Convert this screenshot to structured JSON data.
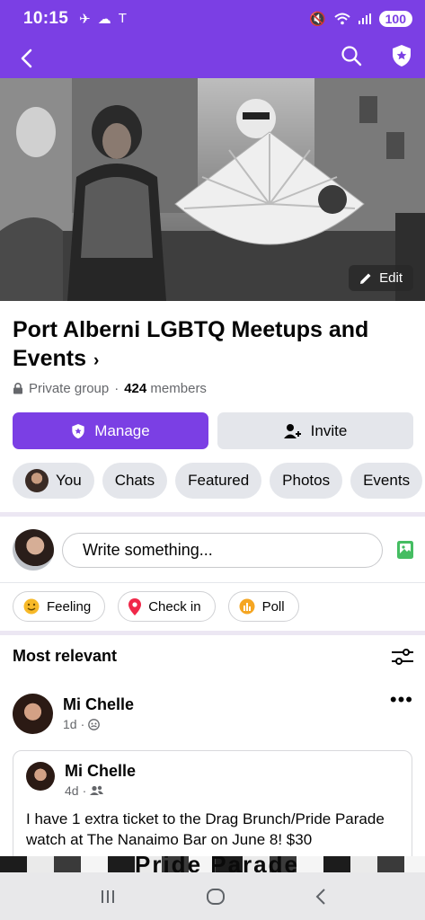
{
  "status_bar": {
    "time": "10:15",
    "battery": "100"
  },
  "cover": {
    "edit_label": "Edit"
  },
  "group": {
    "name": "Port Alberni LGBTQ Meetups and Events",
    "privacy": "Private group",
    "members_count": "424",
    "members_label": "members"
  },
  "buttons": {
    "manage": "Manage",
    "invite": "Invite"
  },
  "chips": [
    {
      "label": "You"
    },
    {
      "label": "Chats"
    },
    {
      "label": "Featured"
    },
    {
      "label": "Photos"
    },
    {
      "label": "Events"
    }
  ],
  "composer": {
    "placeholder": "Write something..."
  },
  "actions": [
    {
      "label": "Feeling",
      "icon": "smile-icon",
      "color": "#f7b928"
    },
    {
      "label": "Check in",
      "icon": "location-pin-icon",
      "color": "#f02849"
    },
    {
      "label": "Poll",
      "icon": "poll-icon",
      "color": "#f5a623"
    }
  ],
  "feed": {
    "sort_label": "Most relevant"
  },
  "post": {
    "author": "Mi Chelle",
    "time": "1d",
    "shared": {
      "author": "Mi Chelle",
      "time": "4d",
      "text": "I have 1 extra ticket to the Drag Brunch/Pride Parade watch at The Nanaimo Bar on June 8!  $30"
    }
  },
  "banner_text": "Pride Parade",
  "colors": {
    "brand": "#7b3fe4",
    "chip_bg": "#e4e6eb"
  }
}
